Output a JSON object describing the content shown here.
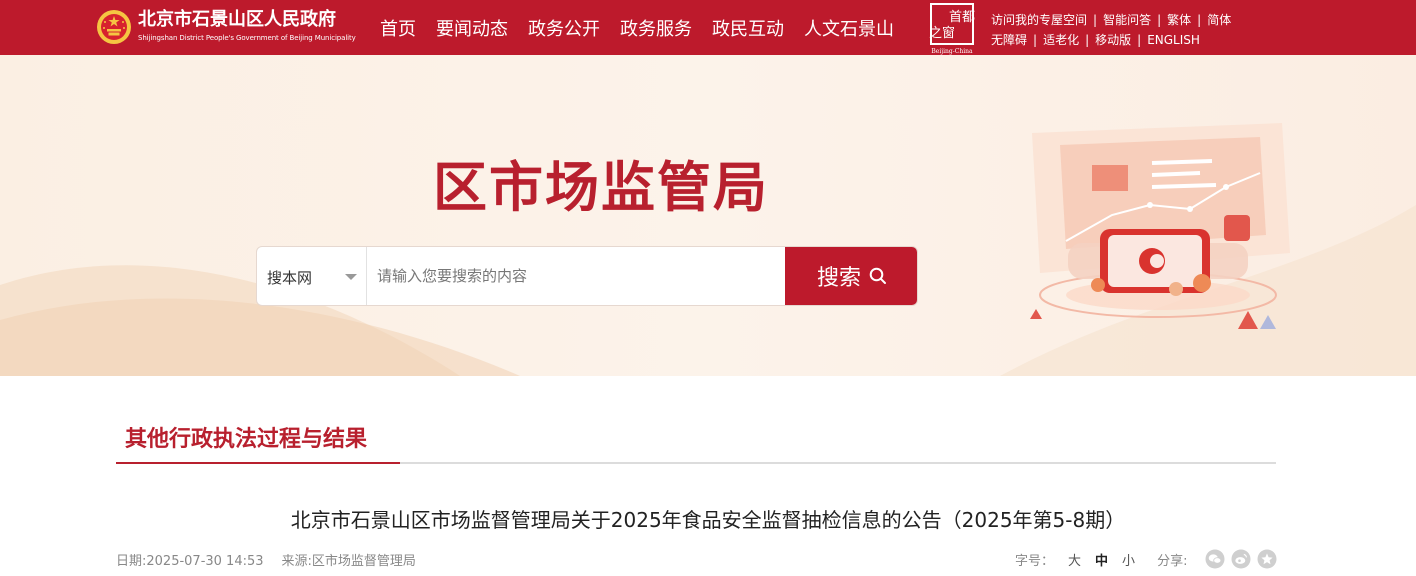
{
  "header": {
    "site_name": "北京市石景山区人民政府",
    "site_name_en": "Shijingshan District People's Government of Beijing Municipality",
    "nav": [
      {
        "label": "首页"
      },
      {
        "label": "要闻动态"
      },
      {
        "label": "政务公开"
      },
      {
        "label": "政务服务"
      },
      {
        "label": "政民互动"
      },
      {
        "label": "人文石景山"
      }
    ],
    "seal_text": [
      "首都",
      "之窗"
    ],
    "seal_en": "Beijing-China",
    "util_links_row1": [
      "访问我的专屋空间",
      "智能问答",
      "繁体",
      "简体"
    ],
    "util_links_row2": [
      "无障碍",
      "适老化",
      "移动版",
      "ENGLISH"
    ],
    "colors": {
      "brand": "#bd1a2c"
    }
  },
  "banner": {
    "title": "区市场监管局",
    "search": {
      "scope_label": "搜本网",
      "placeholder": "请输入您要搜索的内容",
      "button_label": "搜索",
      "icon": "search-icon"
    }
  },
  "section": {
    "title": "其他行政执法过程与结果"
  },
  "article": {
    "title": "北京市石景山区市场监督管理局关于2025年食品安全监督抽检信息的公告（2025年第5-8期）",
    "date": "日期:2025-07-30 14:53",
    "source": "来源:区市场监督管理局",
    "font_size_label": "字号：",
    "font_sizes": [
      "大",
      "中",
      "小"
    ],
    "share_label": "分享:",
    "share_icons": [
      "wechat-icon",
      "weibo-icon",
      "favorite-icon"
    ]
  }
}
